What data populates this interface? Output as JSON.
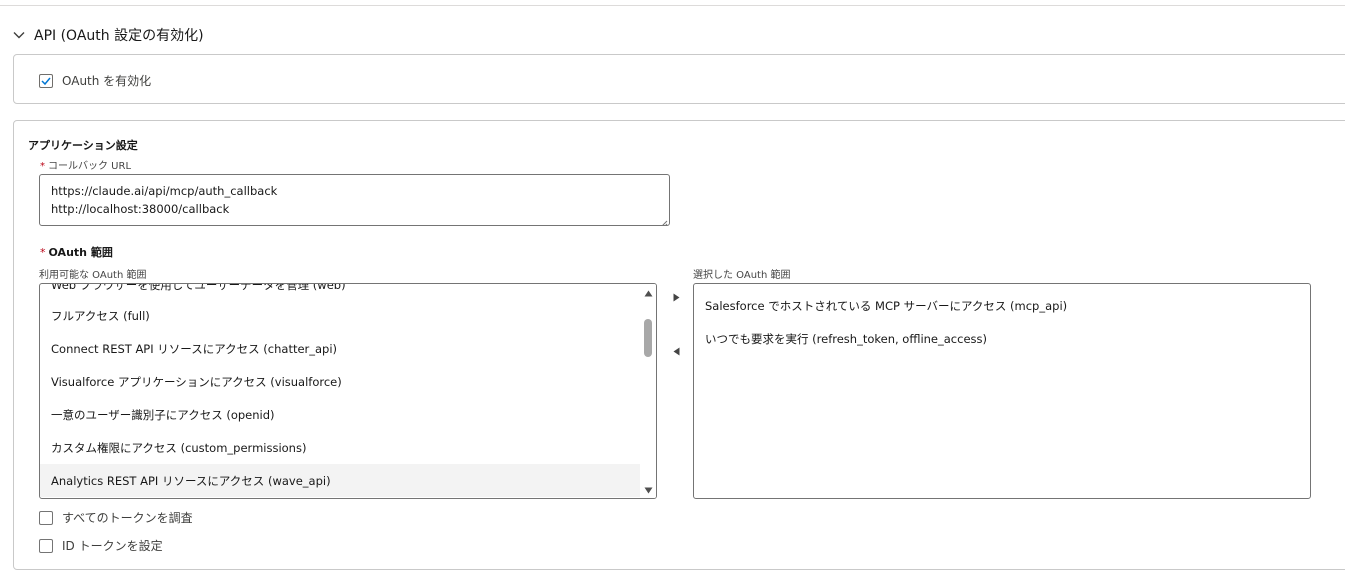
{
  "section": {
    "title": "API (OAuth 設定の有効化)"
  },
  "enable_oauth": {
    "label": "OAuth を有効化",
    "checked": true
  },
  "app_settings": {
    "heading": "アプリケーション設定",
    "callback_label": "コールバック URL",
    "callback_lines": [
      "https://claude.ai/api/mcp/auth_callback",
      "http://localhost:38000/callback"
    ]
  },
  "oauth_scopes": {
    "label": "OAuth 範囲",
    "available_label": "利用可能な OAuth 範囲",
    "selected_label": "選択した OAuth 範囲",
    "available": [
      "Web ブラウザーを使用してユーザーデータを管理 (web)",
      "フルアクセス (full)",
      "Connect REST API リソースにアクセス (chatter_api)",
      "Visualforce アプリケーションにアクセス (visualforce)",
      "一意のユーザー識別子にアクセス (openid)",
      "カスタム権限にアクセス (custom_permissions)",
      "Analytics REST API リソースにアクセス (wave_api)"
    ],
    "selected": [
      "Salesforce でホストされている MCP サーバーにアクセス (mcp_api)",
      "いつでも要求を実行 (refresh_token, offline_access)"
    ]
  },
  "options": {
    "introspect_all_tokens": "すべてのトークンを調査",
    "configure_id_token": "ID トークンを設定"
  },
  "colors": {
    "required": "#ba0517",
    "border": "#c9c9c9",
    "highlight": "#f3f3f3"
  }
}
